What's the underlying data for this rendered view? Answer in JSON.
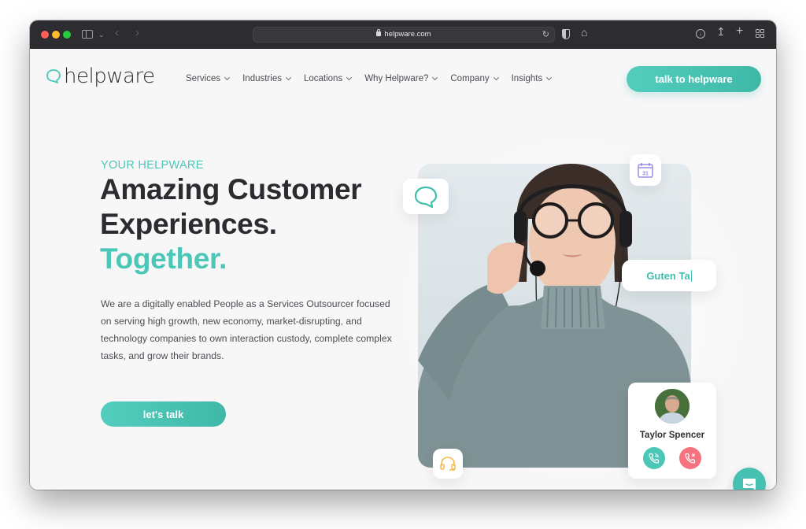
{
  "browser": {
    "url": "helpware.com",
    "colors": {
      "titlebar": "#2d2c31",
      "close": "#fe5f57",
      "minimize": "#febc2e",
      "maximize": "#28c840"
    }
  },
  "header": {
    "logo_text": "helpware",
    "nav": [
      {
        "label": "Services"
      },
      {
        "label": "Industries"
      },
      {
        "label": "Locations"
      },
      {
        "label": "Why Helpware?"
      },
      {
        "label": "Company"
      },
      {
        "label": "Insights"
      }
    ],
    "cta_label": "talk to helpware"
  },
  "hero": {
    "eyebrow": "YOUR HELPWARE",
    "headline_line1": "Amazing Customer",
    "headline_line2": "Experiences.",
    "headline_accent": "Together.",
    "description": "We are a digitally enabled People as a Services Outsourcer focused on serving high growth, new economy, market-disrupting, and technology companies to own interaction custody, complete complex tasks, and grow their brands.",
    "cta_label": "let's talk"
  },
  "visual": {
    "calendar_day": "31",
    "greeting_text": "Guten Ta",
    "caller": {
      "name": "Taylor Spencer"
    }
  },
  "colors": {
    "accent": "#4cc6b6",
    "heading": "#2b2b30",
    "decline": "#f5727f",
    "calendar": "#9b8ae6",
    "headset": "#f6b94e"
  }
}
